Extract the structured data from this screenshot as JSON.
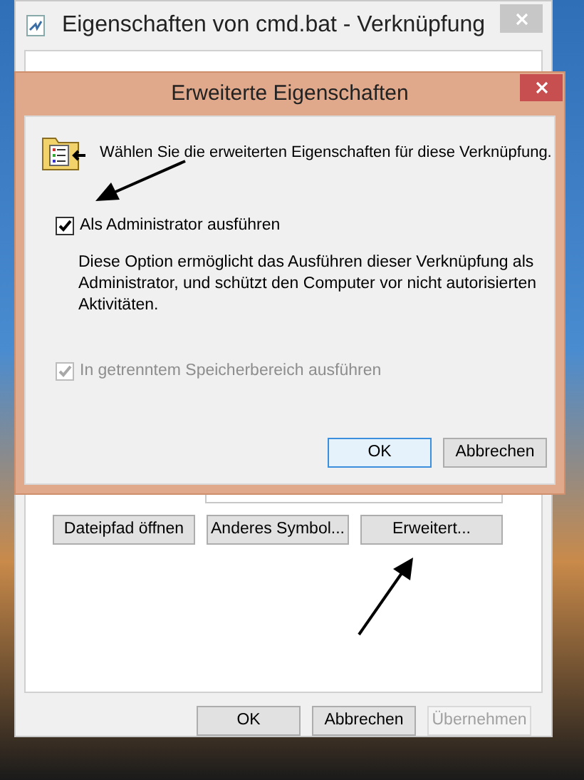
{
  "main_window": {
    "title": "Eigenschaften von cmd.bat - Verknüpfung",
    "buttons": [
      {
        "label": "Dateipfad öffnen"
      },
      {
        "label": "Anderes Symbol..."
      },
      {
        "label": "Erweitert..."
      }
    ],
    "footer_buttons": [
      {
        "label": "OK",
        "disabled": false
      },
      {
        "label": "Abbrechen",
        "disabled": false
      },
      {
        "label": "Übernehmen",
        "disabled": true
      }
    ]
  },
  "dialog": {
    "title": "Erweiterte Eigenschaften",
    "intro": "Wählen Sie die erweiterten Eigenschaften für diese Verknüpfung.",
    "options": [
      {
        "label": "Als Administrator ausführen",
        "checked": true,
        "disabled": false,
        "description": "Diese Option ermöglicht das Ausführen dieser Verknüpfung als Administrator, und schützt den Computer vor nicht autorisierten Aktivitäten."
      },
      {
        "label": "In getrenntem Speicherbereich ausführen",
        "checked": true,
        "disabled": true
      }
    ],
    "buttons": [
      {
        "label": "OK",
        "default": true
      },
      {
        "label": "Abbrechen",
        "default": false
      }
    ]
  }
}
